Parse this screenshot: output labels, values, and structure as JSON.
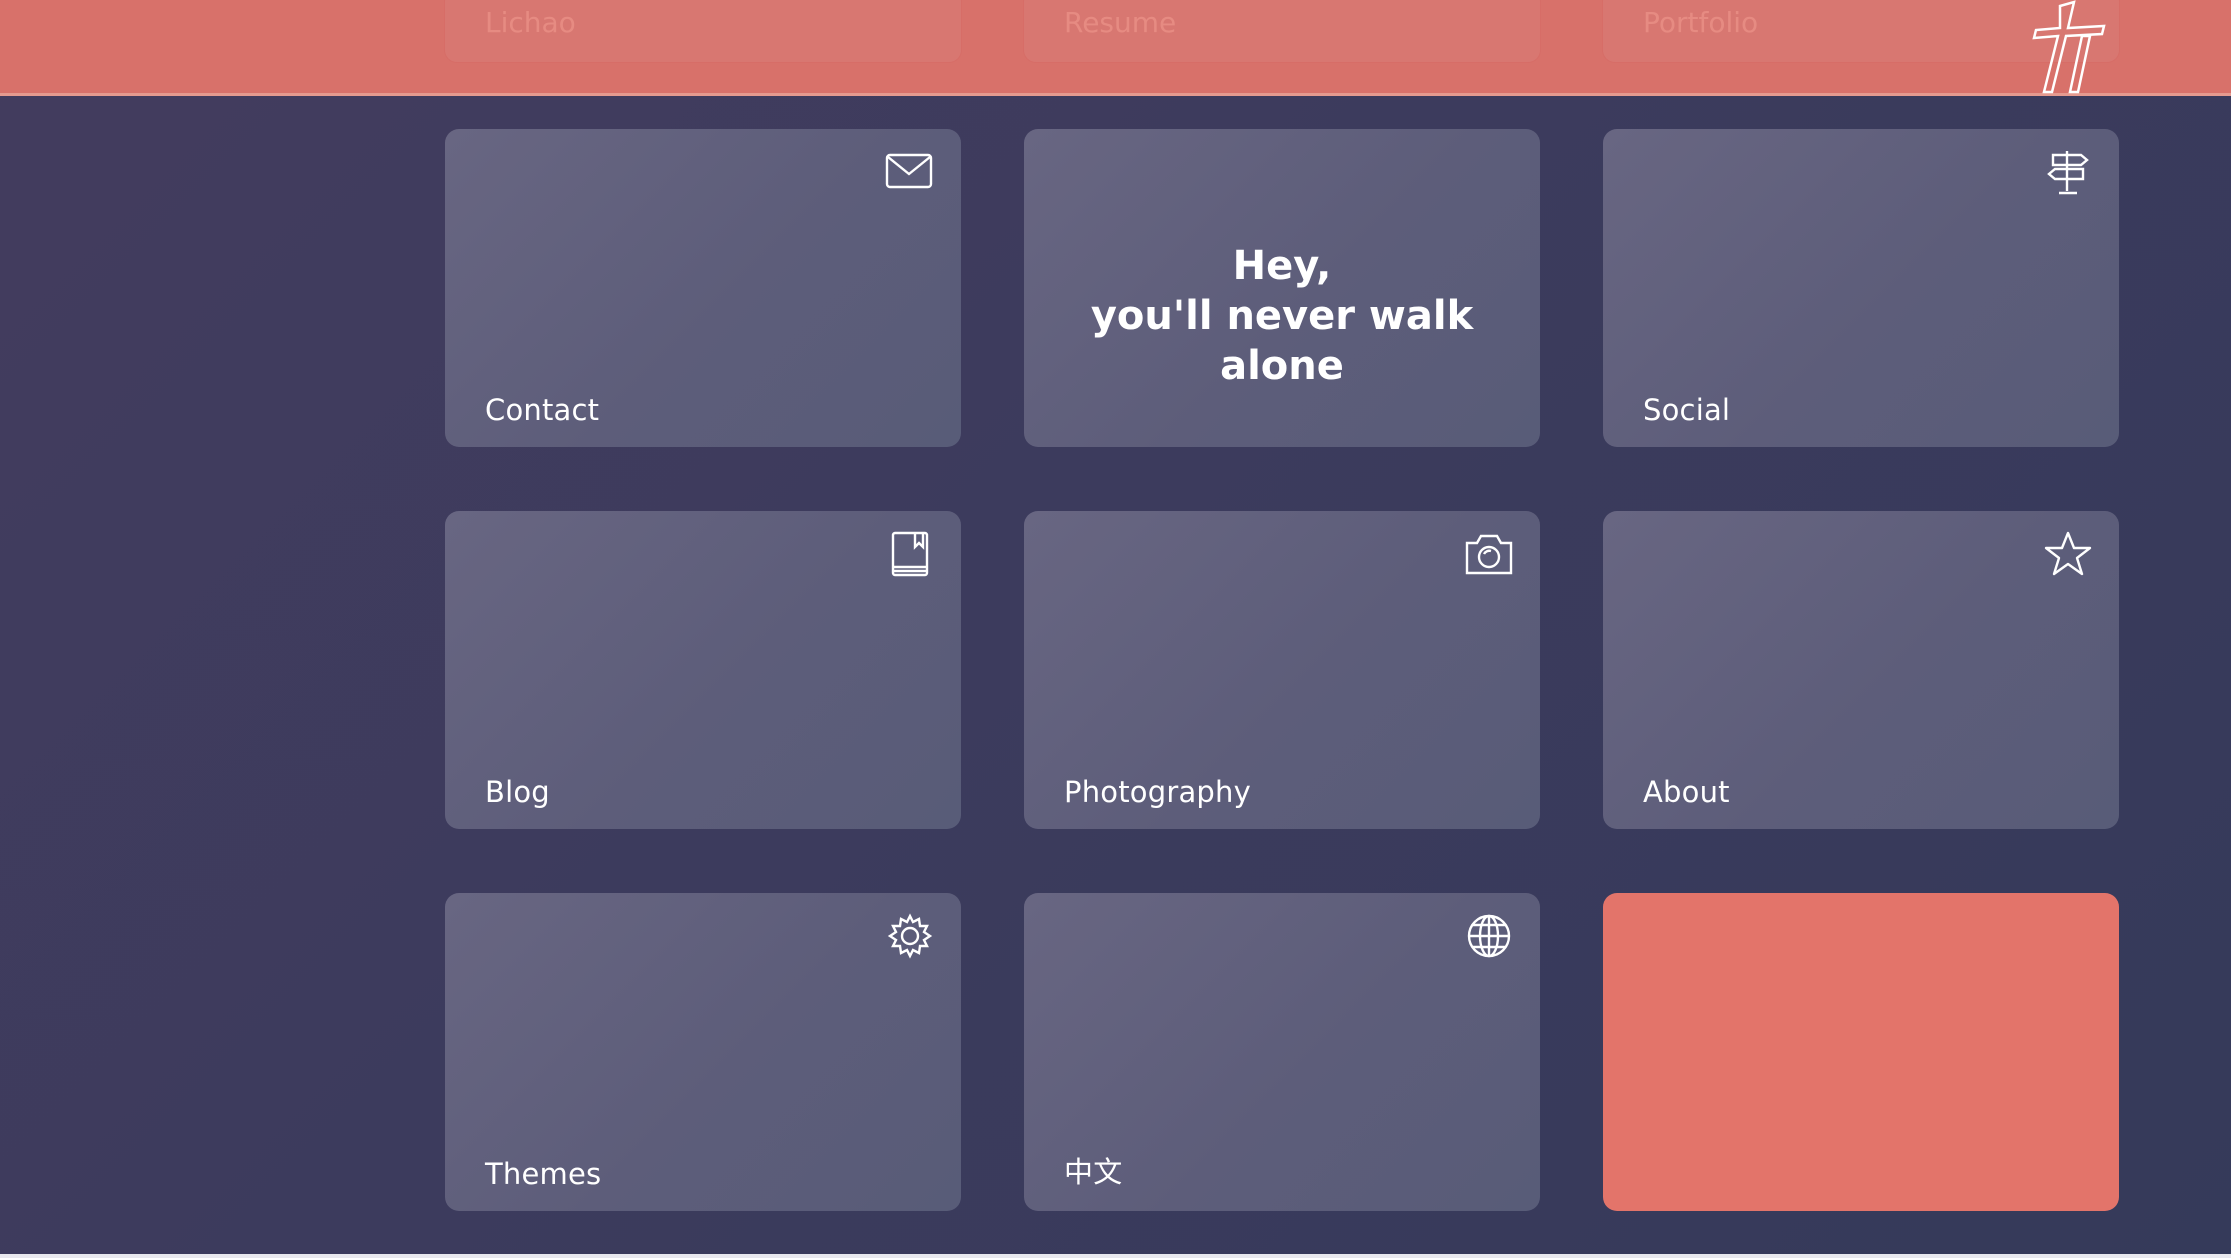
{
  "nav": {
    "tabs": [
      {
        "label": "Lichao"
      },
      {
        "label": "Resume"
      },
      {
        "label": "Portfolio"
      }
    ],
    "logo_icon": "hieroglyph-logo-icon"
  },
  "tiles": {
    "contact": {
      "label": "Contact",
      "icon": "envelope-icon"
    },
    "greeting": {
      "line1": "Hey,",
      "line2": "you'll never walk alone"
    },
    "social": {
      "label": "Social",
      "icon": "signpost-icon"
    },
    "blog": {
      "label": "Blog",
      "icon": "book-icon"
    },
    "photography": {
      "label": "Photography",
      "icon": "camera-icon"
    },
    "about": {
      "label": "About",
      "icon": "star-icon"
    },
    "themes": {
      "label": "Themes",
      "icon": "gear-icon"
    },
    "language": {
      "label": "中文",
      "icon": "globe-icon"
    }
  },
  "colors": {
    "accent": "#e3746a",
    "topbar": "#d8716a",
    "background": "#3c3b5d",
    "tile": "#5f5e7b"
  }
}
